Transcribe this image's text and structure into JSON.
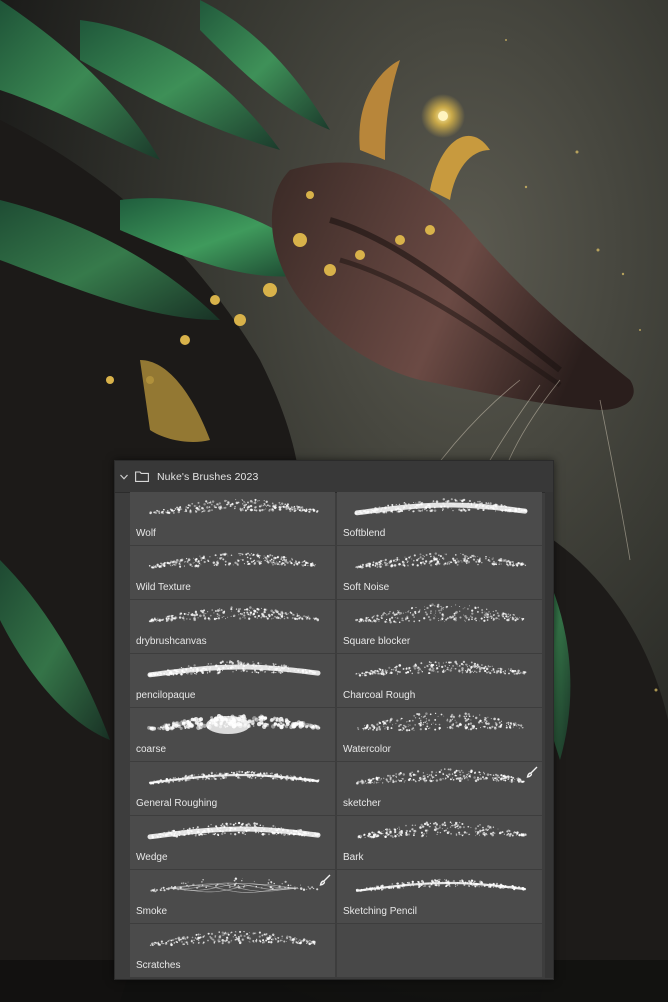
{
  "panel": {
    "group_name": "Nuke's Brushes 2023",
    "brushes": [
      {
        "label": "Wolf",
        "style": "rough",
        "variant": 1
      },
      {
        "label": "Softblend",
        "style": "soft",
        "variant": 2
      },
      {
        "label": "Wild Texture",
        "style": "streaks",
        "variant": 3
      },
      {
        "label": "Soft Noise",
        "style": "noise",
        "variant": 4
      },
      {
        "label": "drybrushcanvas",
        "style": "rough",
        "variant": 5
      },
      {
        "label": "Square blocker",
        "style": "block",
        "variant": 6
      },
      {
        "label": "pencilopaque",
        "style": "soft",
        "variant": 7
      },
      {
        "label": "Charcoal Rough",
        "style": "noise",
        "variant": 8
      },
      {
        "label": "coarse",
        "style": "coarse",
        "variant": 9
      },
      {
        "label": "Watercolor",
        "style": "block",
        "variant": 10
      },
      {
        "label": "General Roughing",
        "style": "thin",
        "variant": 11
      },
      {
        "label": "sketcher",
        "style": "rough",
        "variant": 12,
        "badge": "brush-icon"
      },
      {
        "label": "Wedge",
        "style": "soft",
        "variant": 13
      },
      {
        "label": "Bark",
        "style": "bark",
        "variant": 14
      },
      {
        "label": "Smoke",
        "style": "smoke",
        "variant": 15,
        "badge": "brush-icon"
      },
      {
        "label": "Sketching Pencil",
        "style": "thin",
        "variant": 16
      },
      {
        "label": "Scratches",
        "style": "noise",
        "variant": 17
      }
    ]
  },
  "colors": {
    "panel_bg": "#3d3d3d",
    "tile_bg": "#4b4b4b",
    "text": "#e8e8e8",
    "accent_gold": "#d8b24a",
    "feather_green": "#2f7a4a"
  }
}
